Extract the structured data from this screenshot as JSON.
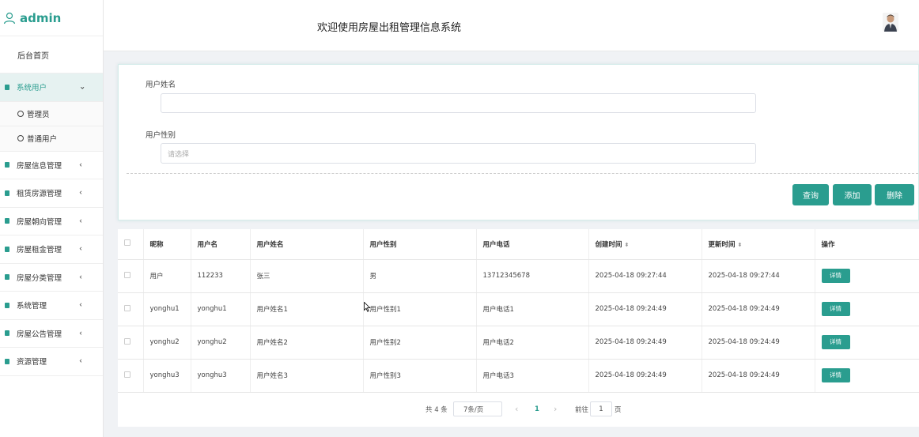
{
  "brand": {
    "text": "admin",
    "icon": "user-icon"
  },
  "header": {
    "title": "欢迎使用房屋出租管理信息系统"
  },
  "sidebar": {
    "home": "后台首页",
    "active_group": {
      "label": "系统用户",
      "sub_items": [
        "管理员",
        "普通用户"
      ]
    },
    "items": [
      "房屋信息管理",
      "租赁房源管理",
      "房屋朝向管理",
      "房屋租金管理",
      "房屋分类管理",
      "系统管理",
      "房屋公告管理",
      "资源管理"
    ]
  },
  "search": {
    "name_label": "用户姓名",
    "name_value": "",
    "gender_label": "用户性别",
    "gender_placeholder": "请选择",
    "buttons": {
      "query": "查询",
      "add": "添加",
      "delete": "删除"
    }
  },
  "table": {
    "headers": [
      "昵称",
      "用户名",
      "用户姓名",
      "用户性别",
      "用户电话",
      "创建时间",
      "更新时间",
      "操作"
    ],
    "rows": [
      [
        "用户",
        "112233",
        "张三",
        "男",
        "13712345678",
        "2025-04-18 09:27:44",
        "2025-04-18 09:27:44"
      ],
      [
        "yonghu1",
        "yonghu1",
        "用户姓名1",
        "用户性别1",
        "用户电话1",
        "2025-04-18 09:24:49",
        "2025-04-18 09:24:49"
      ],
      [
        "yonghu2",
        "yonghu2",
        "用户姓名2",
        "用户性别2",
        "用户电话2",
        "2025-04-18 09:24:49",
        "2025-04-18 09:24:49"
      ],
      [
        "yonghu3",
        "yonghu3",
        "用户姓名3",
        "用户性别3",
        "用户电话3",
        "2025-04-18 09:24:49",
        "2025-04-18 09:24:49"
      ]
    ],
    "detail_label": "详情"
  },
  "pagination": {
    "total": "共 4 条",
    "page_size": "7条/页",
    "prev": "‹",
    "current_page": "1",
    "next": "›",
    "goto_label": "前往",
    "goto_value": "1",
    "page_unit": "页"
  },
  "colors": {
    "accent": "#2a9d8f"
  }
}
